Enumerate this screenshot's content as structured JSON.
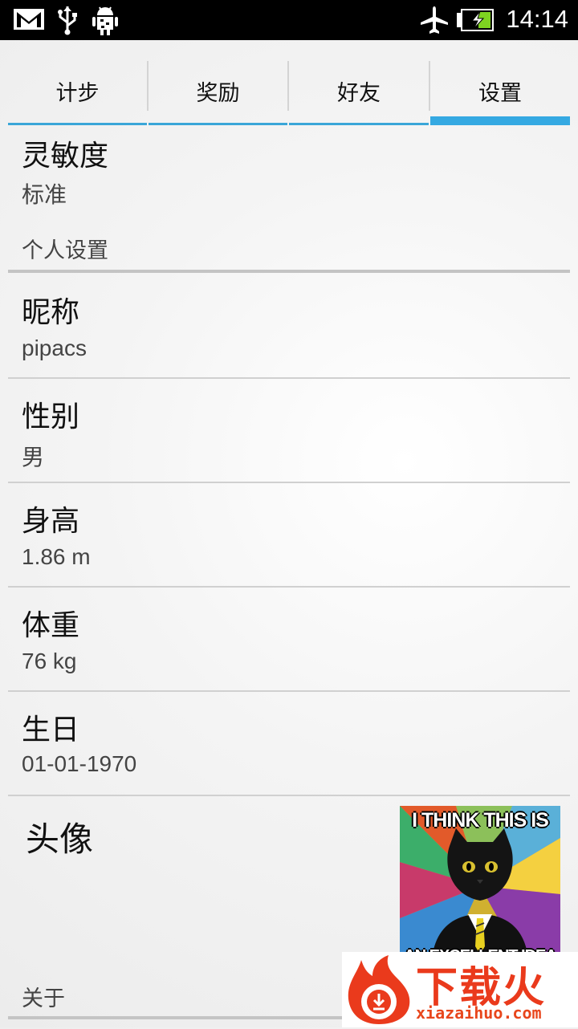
{
  "status_bar": {
    "time": "14:14",
    "icons": [
      "gmail-icon",
      "usb-icon",
      "android-debug-icon",
      "airplane-mode-icon",
      "battery-charging-icon"
    ]
  },
  "tabs": [
    {
      "label": "计步",
      "selected": false
    },
    {
      "label": "奖励",
      "selected": false
    },
    {
      "label": "好友",
      "selected": false
    },
    {
      "label": "设置",
      "selected": true
    }
  ],
  "sensitivity": {
    "title": "灵敏度",
    "value": "标准"
  },
  "personal_section": {
    "header": "个人设置"
  },
  "nickname": {
    "title": "昵称",
    "value": "pipacs"
  },
  "gender": {
    "title": "性别",
    "value": "男"
  },
  "height": {
    "title": "身高",
    "value": "1.86 m"
  },
  "weight": {
    "title": "体重",
    "value": "76 kg"
  },
  "birthday": {
    "title": "生日",
    "value": "01-01-1970"
  },
  "avatar": {
    "title": "头像",
    "image_top_text": "I THINK THIS IS",
    "image_bottom_text": "AN EXCELLENT IDEA"
  },
  "about_section": {
    "header": "关于"
  },
  "watermark": {
    "text": "下载火",
    "subtext": "xiazaihuo.com"
  },
  "colors": {
    "accent": "#35a9e2",
    "brand": "#ea3a1c"
  }
}
